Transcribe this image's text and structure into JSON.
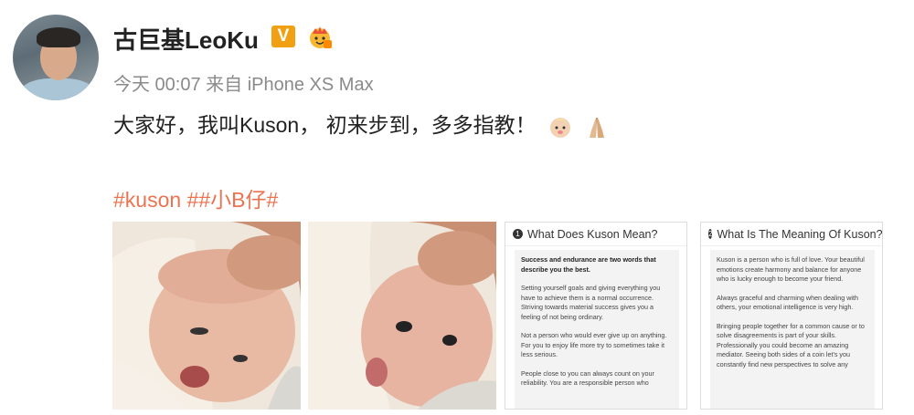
{
  "post": {
    "author_name": "古巨基LeoKu",
    "verified_badge": "V",
    "timestamp": "今天 00:07",
    "source": "来自 iPhone XS Max",
    "content": "大家好，我叫Kuson， 初来步到，多多指教！",
    "hashtags": [
      "#kuson",
      "##小B仔#"
    ]
  },
  "cards": [
    {
      "number": "1",
      "title": "What Does Kuson Mean?",
      "paragraphs": [
        "Success and endurance are two words that describe you the best.",
        "Setting yourself goals and giving everything you have to achieve them is a normal occurrence. Striving towards material success gives you a feeling of not being ordinary.",
        "Not a person who would ever give up on anything. For you to enjoy life more try to sometimes take it less serious.",
        "People close to you can always count on your reliability. You are a responsible person who"
      ]
    },
    {
      "number": "2",
      "title": "What Is The Meaning Of Kuson?",
      "paragraphs": [
        "Kuson is a person who is full of love. Your beautiful emotions create harmony and balance for anyone who is lucky enough to become your friend.",
        "Always graceful and charming when dealing with others, your emotional intelligence is very high.",
        "Bringing people together for a common cause or to solve disagreements is part of your skills. Professionally you could become an amazing mediator. Seeing both sides of a coin let's you constantly find new perspectives to solve any"
      ]
    }
  ],
  "icons": {
    "badge_crown": "crown-badge-icon",
    "emoji_baby": "baby-emoji-icon",
    "emoji_pray": "folded-hands-emoji-icon"
  },
  "colors": {
    "hashtag": "#eb7350",
    "verified": "#f0a012",
    "meta_text": "#8a8a8a"
  }
}
